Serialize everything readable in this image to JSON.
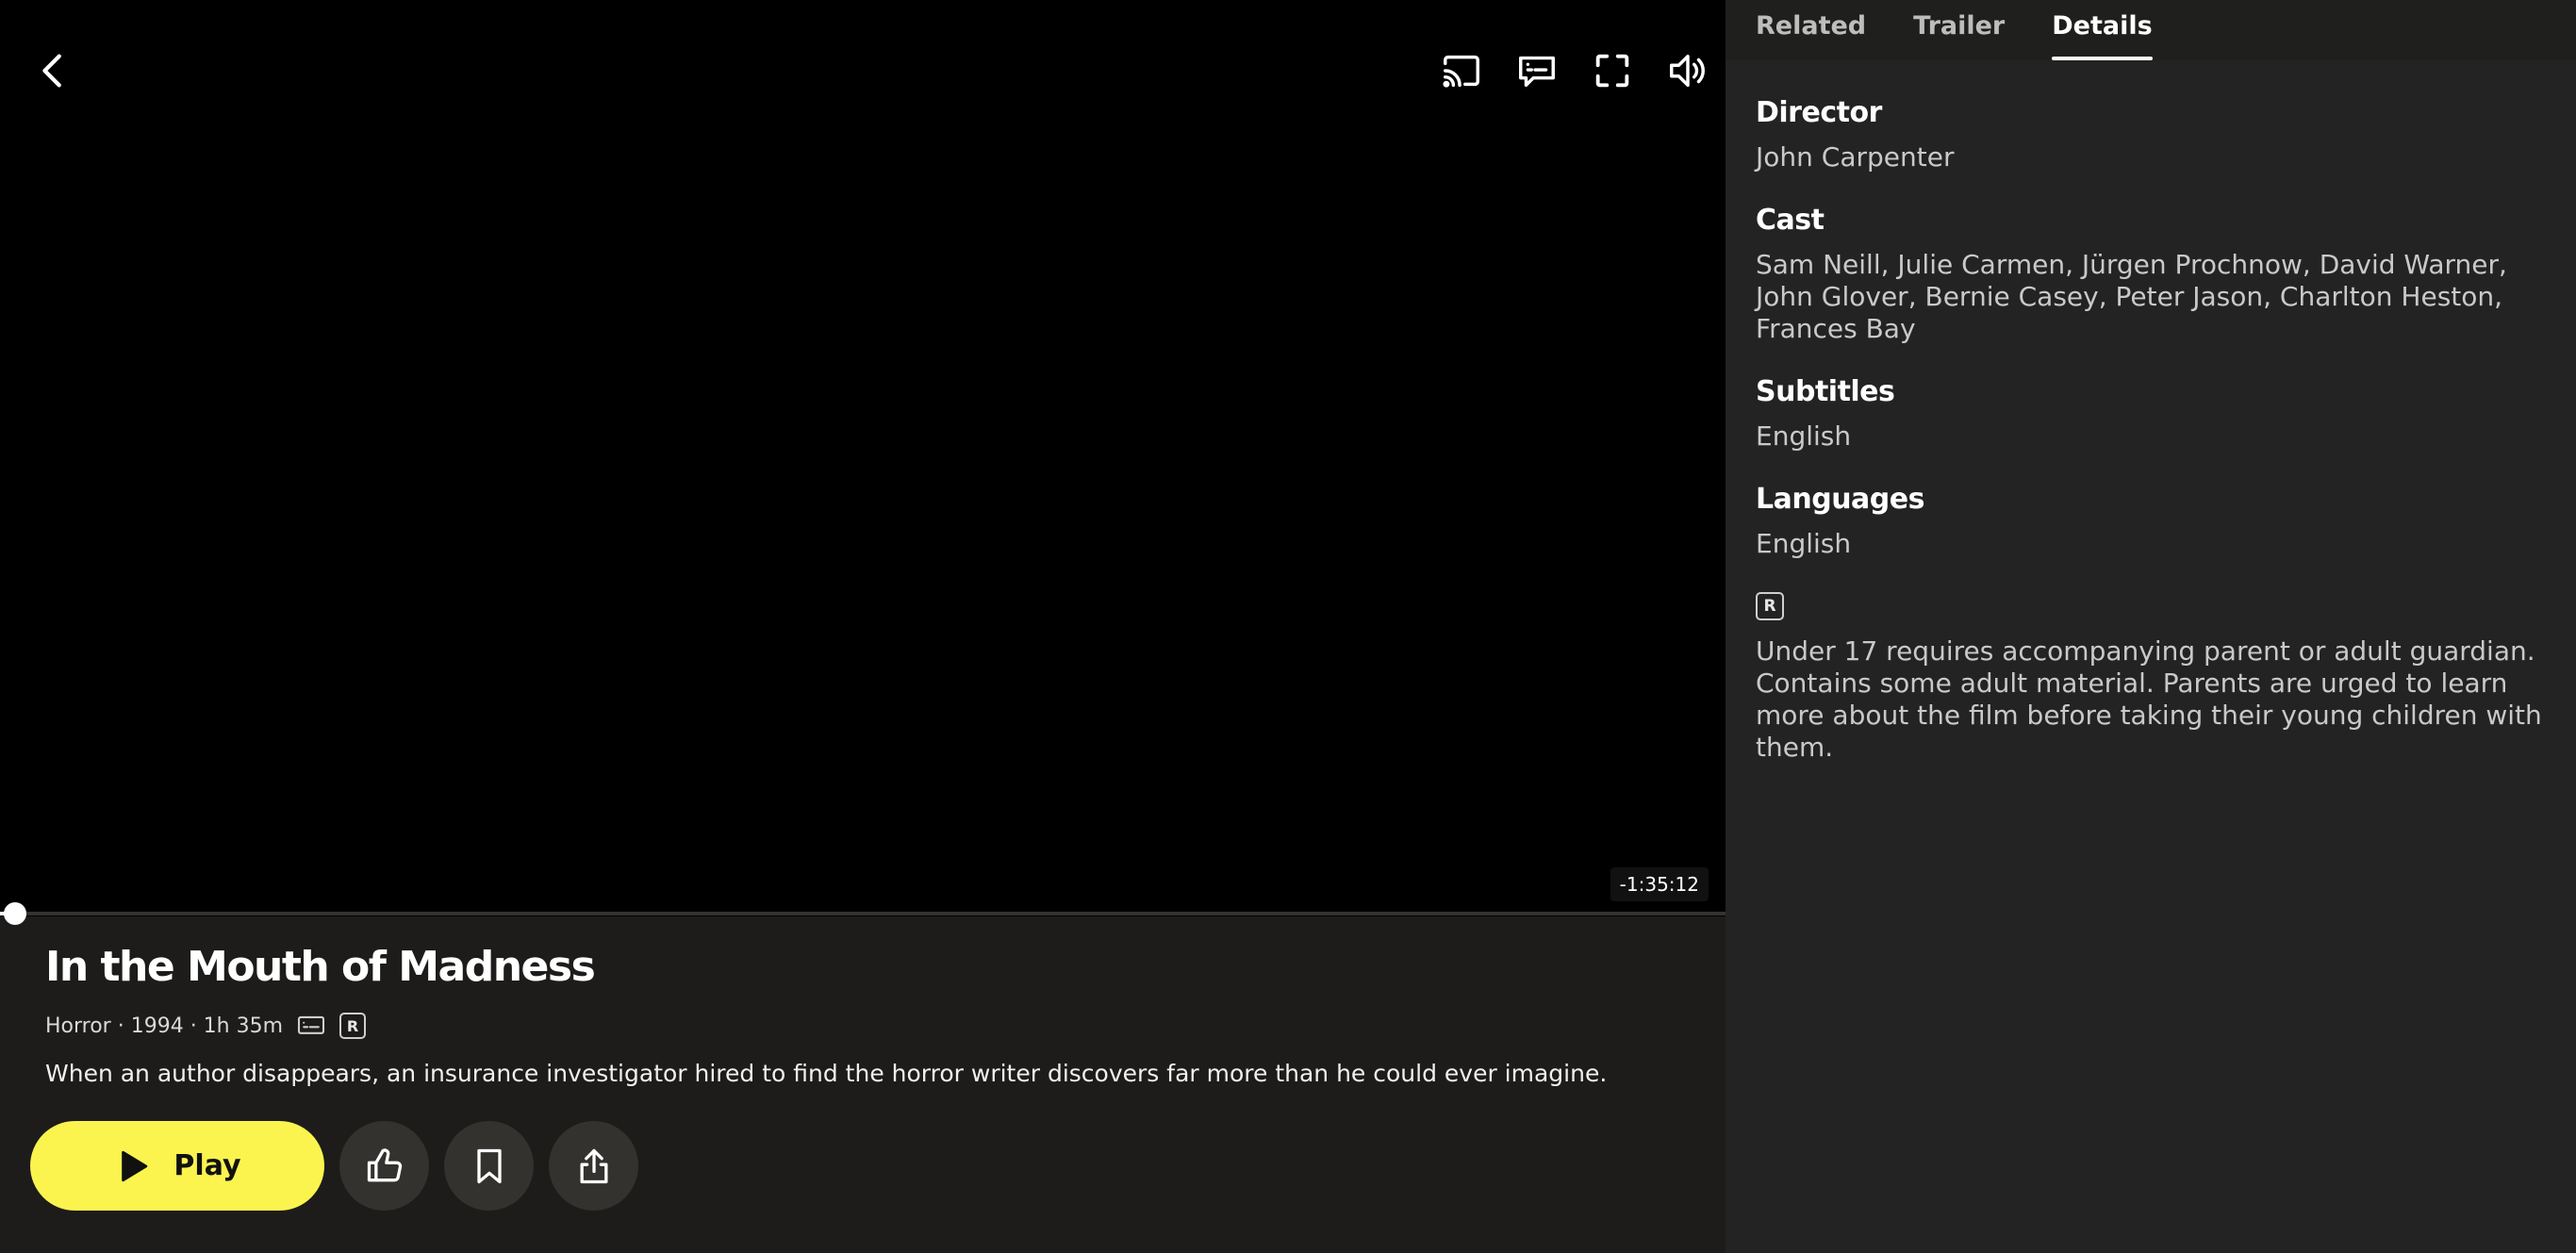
{
  "player": {
    "time_remaining": "-1:35:12",
    "progress": 0.003
  },
  "movie": {
    "title": "In the Mouth of Madness",
    "genre_year_runtime": "Horror · 1994 · 1h 35m",
    "rating": "R",
    "description": "When an author disappears, an insurance investigator hired to find the horror writer discovers far more than he could ever imagine."
  },
  "actions": {
    "play_label": "Play"
  },
  "tabs": [
    {
      "label": "Related",
      "active": false
    },
    {
      "label": "Trailer",
      "active": false
    },
    {
      "label": "Details",
      "active": true
    }
  ],
  "details": {
    "director_heading": "Director",
    "director": "John Carpenter",
    "cast_heading": "Cast",
    "cast": "Sam Neill, Julie Carmen, Jürgen Prochnow, David Warner, John Glover, Bernie Casey, Peter Jason, Charlton Heston, Frances Bay",
    "subtitles_heading": "Subtitles",
    "subtitles": "English",
    "languages_heading": "Languages",
    "languages": "English",
    "rating": "R",
    "rating_advisory": "Under 17 requires accompanying parent or adult guardian. Contains some adult material. Parents are urged to learn more about the film before taking their young children with them."
  },
  "icons": {
    "back": "chevron-left-icon",
    "cast": "cast-icon",
    "subtitles": "subtitles-icon",
    "fullscreen": "fullscreen-icon",
    "volume": "volume-icon",
    "play": "play-icon",
    "like": "thumbs-up-icon",
    "bookmark": "bookmark-icon",
    "share": "share-icon"
  },
  "colors": {
    "accent": "#fbf44f",
    "video_bg": "#000000",
    "panel_bg": "#232323",
    "page_bg": "#1d1c1a"
  }
}
